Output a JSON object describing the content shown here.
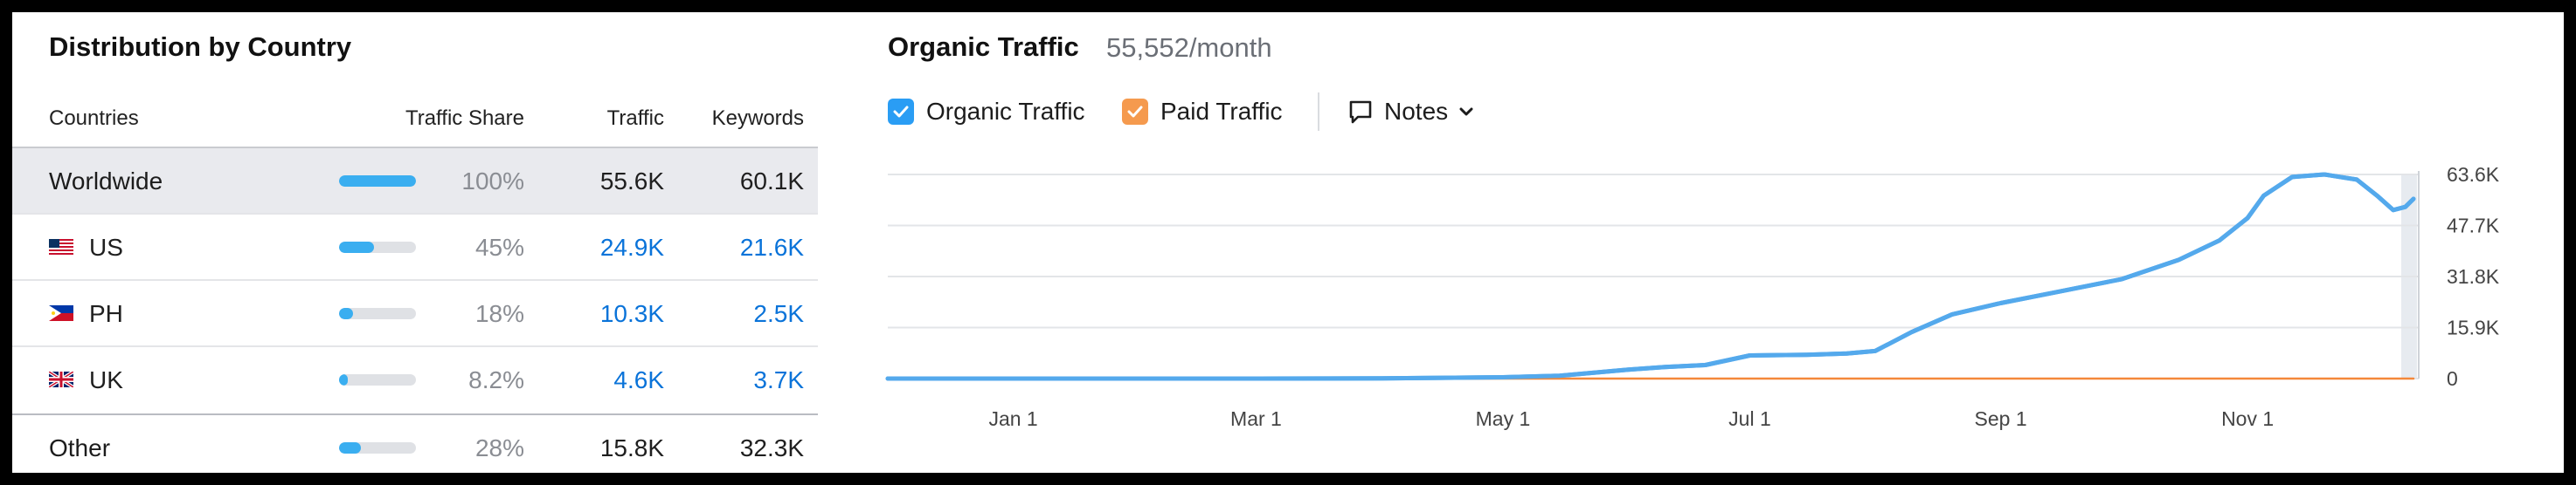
{
  "distribution": {
    "title": "Distribution by Country",
    "columns": {
      "countries": "Countries",
      "share": "Traffic Share",
      "traffic": "Traffic",
      "keywords": "Keywords"
    },
    "rows": [
      {
        "country": "Worldwide",
        "share": "100%",
        "share_fraction": 1.0,
        "traffic": "55.6K",
        "keywords": "60.1K",
        "flag": ""
      },
      {
        "country": "US",
        "share": "45%",
        "share_fraction": 0.45,
        "traffic": "24.9K",
        "keywords": "21.6K",
        "flag": "us-flag-icon"
      },
      {
        "country": "PH",
        "share": "18%",
        "share_fraction": 0.18,
        "traffic": "10.3K",
        "keywords": "2.5K",
        "flag": "ph-flag-icon"
      },
      {
        "country": "UK",
        "share": "8.2%",
        "share_fraction": 0.082,
        "traffic": "4.6K",
        "keywords": "3.7K",
        "flag": "uk-flag-icon"
      },
      {
        "country": "Other",
        "share": "28%",
        "share_fraction": 0.28,
        "traffic": "15.8K",
        "keywords": "32.3K",
        "flag": ""
      }
    ],
    "colors": {
      "bar": "#3aaef0",
      "link": "#0a73d9",
      "highlight": "#e9eaee"
    }
  },
  "organic": {
    "title": "Organic Traffic",
    "value": "55,552/month",
    "legend": {
      "organic": "Organic Traffic",
      "paid": "Paid Traffic",
      "notes": "Notes"
    },
    "colors": {
      "organic": "#54a9ec",
      "paid": "#f4883a",
      "checkbox_blue": "#2a9df4",
      "checkbox_orange": "#f59a4e"
    }
  },
  "chart_data": {
    "type": "line",
    "x_tick_labels": [
      "Jan 1",
      "Mar 1",
      "May 1",
      "Jul 1",
      "Sep 1",
      "Nov 1"
    ],
    "y_tick_labels": [
      "63.6K",
      "47.7K",
      "31.8K",
      "15.9K",
      "0"
    ],
    "ylim": [
      0,
      63600
    ],
    "grid": true,
    "series": [
      {
        "name": "Organic Traffic",
        "color": "#54a9ec",
        "points": [
          [
            "2023-12-01",
            0
          ],
          [
            "2024-01-01",
            0
          ],
          [
            "2024-02-01",
            0
          ],
          [
            "2024-03-01",
            0
          ],
          [
            "2024-04-01",
            80
          ],
          [
            "2024-05-01",
            400
          ],
          [
            "2024-05-15",
            900
          ],
          [
            "2024-06-01",
            2800
          ],
          [
            "2024-06-10",
            3600
          ],
          [
            "2024-06-20",
            4200
          ],
          [
            "2024-07-01",
            7200
          ],
          [
            "2024-07-15",
            7400
          ],
          [
            "2024-07-25",
            7800
          ],
          [
            "2024-08-01",
            8600
          ],
          [
            "2024-08-10",
            14500
          ],
          [
            "2024-08-20",
            20000
          ],
          [
            "2024-09-01",
            23500
          ],
          [
            "2024-09-15",
            27000
          ],
          [
            "2024-10-01",
            31000
          ],
          [
            "2024-10-15",
            37000
          ],
          [
            "2024-10-25",
            43000
          ],
          [
            "2024-11-01",
            50000
          ],
          [
            "2024-11-05",
            57000
          ],
          [
            "2024-11-12",
            62800
          ],
          [
            "2024-11-20",
            63600
          ],
          [
            "2024-11-28",
            62000
          ],
          [
            "2024-12-03",
            57000
          ],
          [
            "2024-12-07",
            52500
          ],
          [
            "2024-12-10",
            53500
          ],
          [
            "2024-12-12",
            56000
          ]
        ]
      },
      {
        "name": "Paid Traffic",
        "color": "#f4883a",
        "points": [
          [
            "2023-12-01",
            0
          ],
          [
            "2024-12-12",
            0
          ]
        ]
      }
    ]
  }
}
